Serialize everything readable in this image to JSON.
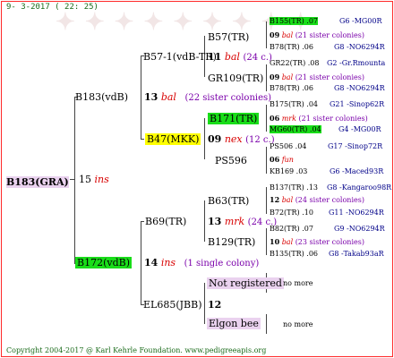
{
  "date": "9- 3-2017 ( 22: 25)",
  "footer": "Copyright 2004-2017 @ Karl Kehrle Foundation. www.pedigreeapis.org",
  "root": {
    "name": "B183(GRA)",
    "num": "15",
    "tag": "ins"
  },
  "father": {
    "name": "B183(vdB)",
    "num": "13",
    "tag": "bal",
    "note": "(22 sister colonies)"
  },
  "mother": {
    "name": "B172(vdB)",
    "num": "14",
    "tag": "ins",
    "note": "(1 single colony)"
  },
  "gf1": {
    "name": "B57-1(vdB-TR)",
    "num": "11",
    "tag": "bal",
    "note": "(24 c.)"
  },
  "gm1": {
    "name": "B47(MKK)",
    "num": "09",
    "tag": "nex",
    "note": "(12 c.)"
  },
  "gf2": {
    "name": "B69(TR)",
    "num": "13",
    "tag": "mrk",
    "note": "(24 c.)"
  },
  "gm2": {
    "name": "EL685(JBB)",
    "num": "12"
  },
  "g3": [
    {
      "name": "B57(TR)",
      "num": "09",
      "tag": "bal",
      "note": "(21 sister colonies)"
    },
    {
      "name": "GR109(TR)",
      "num": "09",
      "tag": "bal",
      "note": "(21 sister colonies)"
    },
    {
      "name": "B171(TR)",
      "num": "06",
      "tag": "mrk",
      "note": "(21 sister colonies)"
    },
    {
      "name": "PS596",
      "num": "06",
      "tag": "fun"
    },
    {
      "name": "B63(TR)",
      "num": "12",
      "tag": "bal",
      "note": "(24 sister colonies)"
    },
    {
      "name": "B129(TR)",
      "num": "10",
      "tag": "bal",
      "note": "(23 sister colonies)"
    },
    {
      "name": "Not registered",
      "more": "no more"
    },
    {
      "name": "Elgon bee",
      "more": "no more"
    }
  ],
  "g4": [
    {
      "name": "B155(TR) .07",
      "right": "G6 -MG00R"
    },
    {
      "name": "B78(TR) .06",
      "right": "G8 -NO6294R"
    },
    {
      "name": "GR22(TR) .08",
      "right": "G2 -Gr.Rmounta"
    },
    {
      "name": "B78(TR) .06",
      "right": "G8 -NO6294R"
    },
    {
      "name": "B175(TR) .04",
      "right": "G21 -Sinop62R"
    },
    {
      "name": "MG60(TR) .04",
      "right": "G4 -MG00R"
    },
    {
      "name": "PS506 .04",
      "right": "G17 -Sinop72R"
    },
    {
      "name": "KB169 .03",
      "right": "G6 -Maced93R"
    },
    {
      "name": "B137(TR) .13",
      "right": "G8 -Kangaroo98R"
    },
    {
      "name": "B72(TR) .10",
      "right": "G11 -NO6294R"
    },
    {
      "name": "B82(TR) .07",
      "right": "G9 -NO6294R"
    },
    {
      "name": "B135(TR) .06",
      "right": "G8 -Takab93aR"
    }
  ]
}
